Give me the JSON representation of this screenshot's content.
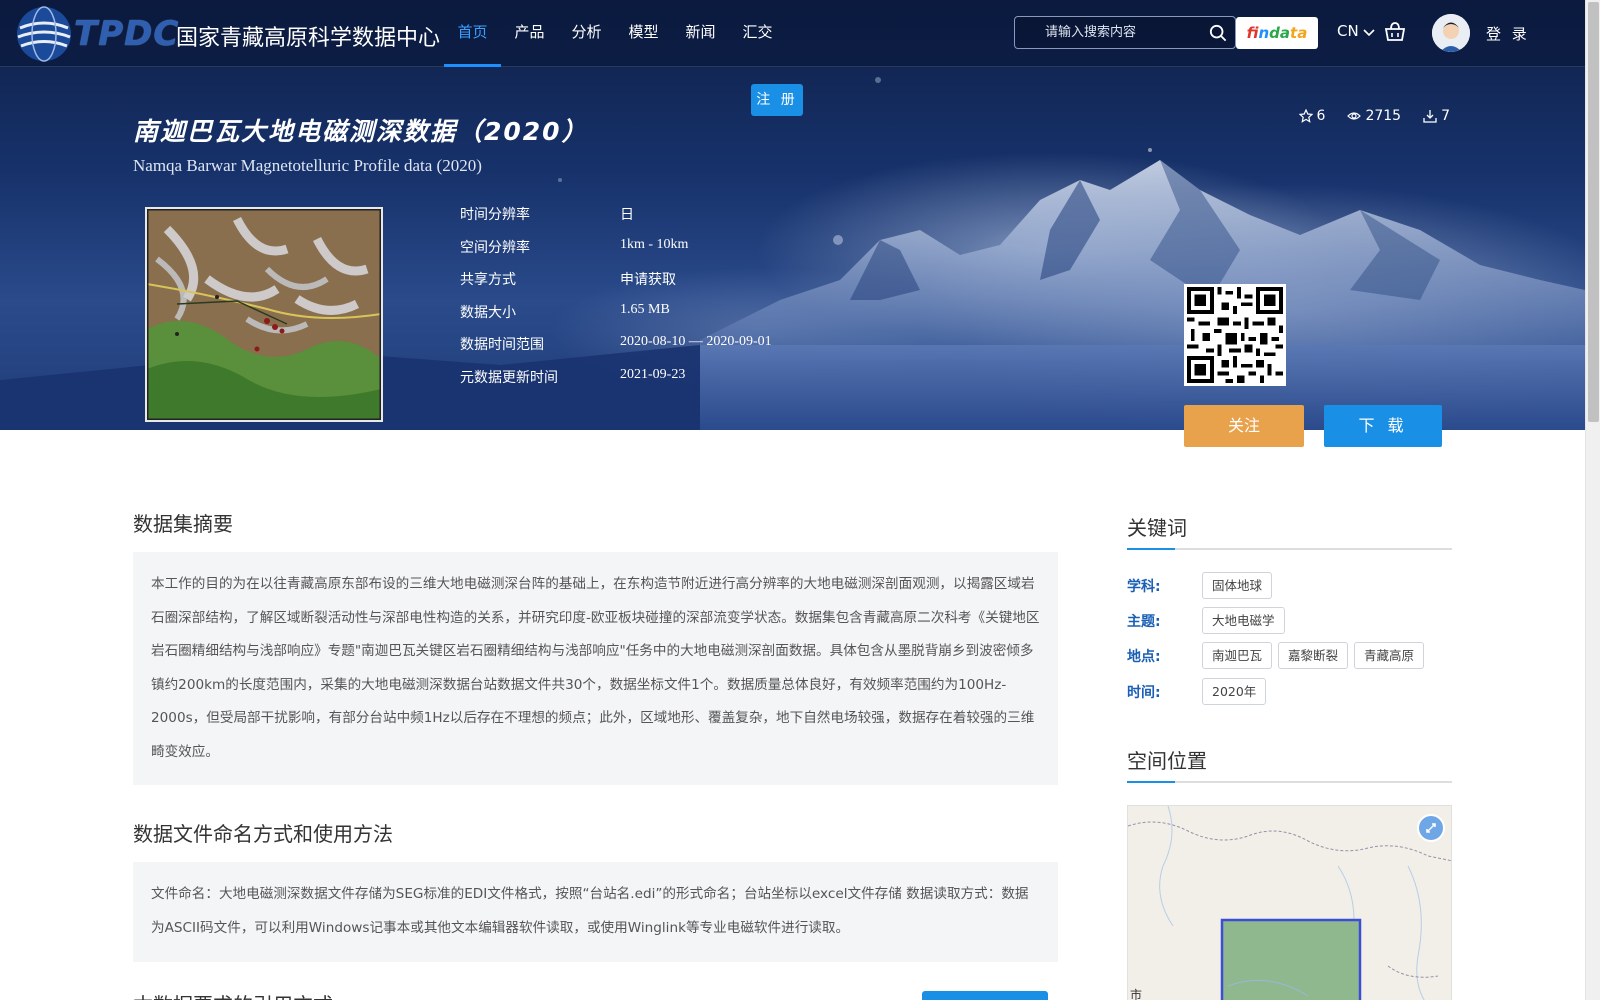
{
  "header": {
    "logo_abbr": "TPDC",
    "logo_name": "国家青藏高原科学数据中心",
    "nav": [
      {
        "label": "首页"
      },
      {
        "label": "产品"
      },
      {
        "label": "分析"
      },
      {
        "label": "模型"
      },
      {
        "label": "新闻"
      },
      {
        "label": "汇交"
      }
    ],
    "active_nav": "首页",
    "search": {
      "placeholder": "请输入搜索内容",
      "value": ""
    },
    "findata": {
      "p1": "f",
      "p2": "in",
      "p3": "da",
      "p4": "ta"
    },
    "language": "CN",
    "login_label": "登 录",
    "register_label": "注 册"
  },
  "dataset": {
    "title_cn": "南迦巴瓦大地电磁测深数据（2020）",
    "title_en": "Namqa Barwar Magnetotelluric Profile data (2020)",
    "stats": {
      "favorites": "6",
      "views": "2715",
      "downloads": "7"
    },
    "metadata": [
      {
        "label": "时间分辨率",
        "value": "日"
      },
      {
        "label": "空间分辨率",
        "value": "1km - 10km"
      },
      {
        "label": "共享方式",
        "value": "申请获取"
      },
      {
        "label": "数据大小",
        "value": "1.65 MB"
      },
      {
        "label": "数据时间范围",
        "value": "2020-08-10 — 2020-09-01"
      },
      {
        "label": "元数据更新时间",
        "value": "2021-09-23"
      }
    ],
    "follow_label": "关注",
    "download_label": "下 载"
  },
  "main": {
    "abstract_title": "数据集摘要",
    "abstract_text": "本工作的目的为在以往青藏高原东部布设的三维大地电磁测深台阵的基础上，在东构造节附近进行高分辨率的大地电磁测深剖面观测，以揭露区域岩石圈深部结构，了解区域断裂活动性与深部电性构造的关系，并研究印度-欧亚板块碰撞的深部流变学状态。数据集包含青藏高原二次科考《关键地区岩石圈精细结构与浅部响应》专题\"南迦巴瓦关键区岩石圈精细结构与浅部响应\"任务中的大地电磁测深剖面数据。具体包含从墨脱背崩乡到波密倾多镇约200km的长度范围内，采集的大地电磁测深数据台站数据文件共30个，数据坐标文件1个。数据质量总体良好，有效频率范围约为100Hz-2000s，但受局部干扰影响，有部分台站中频1Hz以后存在不理想的频点；此外，区域地形、覆盖复杂，地下自然电场较强，数据存在着较强的三维畸变效应。",
    "naming_title": "数据文件命名方式和使用方法",
    "naming_text": "文件命名：大地电磁测深数据文件存储为SEG标准的EDI文件格式，按照“台站名.edi”的形式命名；台站坐标以excel文件存储 数据读取方式：数据为ASCII码文件，可以利用Windows记事本或其他文本编辑器软件读取，或使用Winglink等专业电磁软件进行读取。",
    "partial_title": "本数据要求的引用方式"
  },
  "sidebar": {
    "keywords_title": "关键词",
    "keywords": [
      {
        "label": "学科:",
        "tags": [
          "固体地球"
        ]
      },
      {
        "label": "主题:",
        "tags": [
          "大地电磁学"
        ]
      },
      {
        "label": "地点:",
        "tags": [
          "南迦巴瓦",
          "嘉黎断裂",
          "青藏高原"
        ]
      },
      {
        "label": "时间:",
        "tags": [
          "2020年"
        ]
      }
    ],
    "location_title": "空间位置",
    "map_label": "市"
  },
  "colors": {
    "accent": "#1a8fe6",
    "follow": "#e8a24c",
    "keyword_label": "#1b5fb5",
    "nav_active": "#3ba0ff"
  }
}
